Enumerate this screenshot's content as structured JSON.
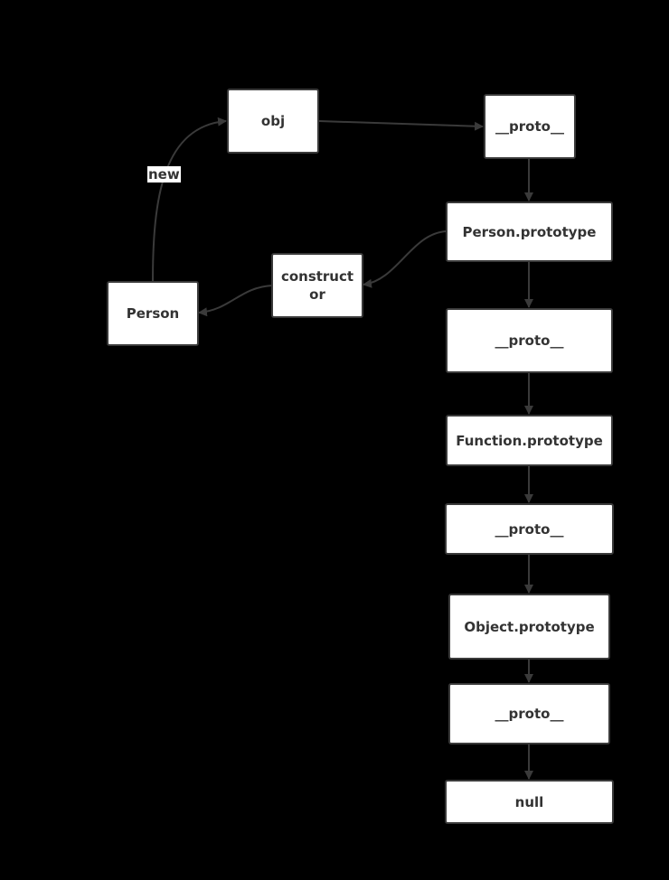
{
  "diagram": {
    "colors": {
      "background": "#000000",
      "node_fill": "#ffffff",
      "node_border": "#3a3a3a",
      "text": "#333333",
      "edge": "#3a3a3a"
    },
    "nodes": {
      "obj": "obj",
      "person": "Person",
      "constructor": "constructor",
      "proto1": "__proto__",
      "person_prototype": "Person.prototype",
      "proto2": "__proto__",
      "function_prototype": "Function.prototype",
      "proto3": "__proto__",
      "object_prototype": "Object.prototype",
      "proto4": "__proto__",
      "null": "null"
    },
    "edge_labels": {
      "new": "new"
    },
    "edges": [
      {
        "from": "person",
        "to": "obj",
        "label": "new"
      },
      {
        "from": "obj",
        "to": "proto1"
      },
      {
        "from": "proto1",
        "to": "person_prototype"
      },
      {
        "from": "person_prototype",
        "to": "constructor"
      },
      {
        "from": "constructor",
        "to": "person"
      },
      {
        "from": "person_prototype",
        "to": "proto2"
      },
      {
        "from": "proto2",
        "to": "function_prototype"
      },
      {
        "from": "function_prototype",
        "to": "proto3"
      },
      {
        "from": "proto3",
        "to": "object_prototype"
      },
      {
        "from": "object_prototype",
        "to": "proto4"
      },
      {
        "from": "proto4",
        "to": "null"
      }
    ]
  }
}
